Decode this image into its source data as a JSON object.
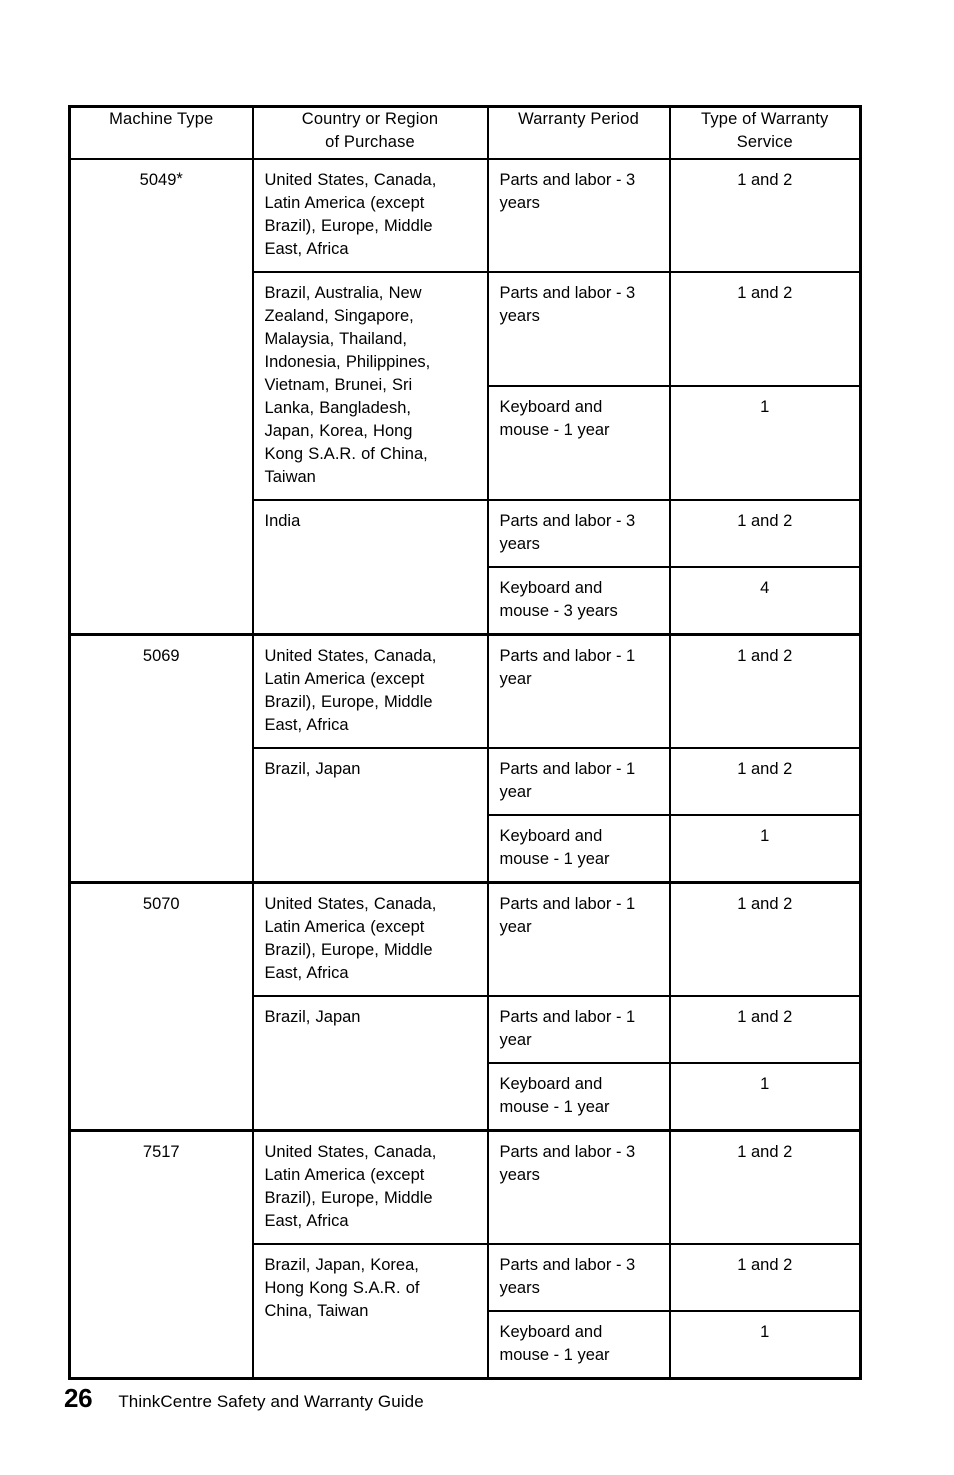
{
  "document": {
    "footer": {
      "page_number": "26",
      "title": "ThinkCentre Safety and Warranty Guide"
    }
  },
  "table": {
    "headers": {
      "machine_type": [
        "Machine Type"
      ],
      "country_or_region": [
        "Country or Region",
        "of Purchase"
      ],
      "warranty_period": [
        "Warranty Period"
      ],
      "type_of_service": [
        "Type of Warranty",
        "Service"
      ]
    },
    "blocks": [
      {
        "machine_type": "5049",
        "machine_type_note": "*",
        "groups": [
          {
            "country_lines": [
              "United States, Canada,",
              "Latin America (except",
              "Brazil), Europe, Middle",
              "East, Africa"
            ],
            "rows": [
              {
                "period_lines": [
                  "Parts and labor - 3",
                  "years"
                ],
                "service": "1 and 2"
              }
            ]
          },
          {
            "country_lines": [
              "Brazil, Australia, New",
              "Zealand, Singapore,",
              "Malaysia, Thailand,",
              "Indonesia, Philippines,",
              "Vietnam, Brunei, Sri",
              "Lanka, Bangladesh,",
              "Japan, Korea, Hong",
              "Kong S.A.R. of China,",
              "Taiwan"
            ],
            "rows": [
              {
                "period_lines": [
                  "Parts and labor - 3",
                  "years"
                ],
                "service": "1 and 2"
              },
              {
                "period_lines": [
                  "Keyboard and",
                  "mouse - 1 year"
                ],
                "service": "1"
              }
            ]
          },
          {
            "country_lines": [
              "India"
            ],
            "rows": [
              {
                "period_lines": [
                  "Parts and labor - 3",
                  "years"
                ],
                "service": "1 and 2"
              },
              {
                "period_lines": [
                  "Keyboard and",
                  "mouse - 3 years"
                ],
                "service": "4"
              }
            ]
          }
        ]
      },
      {
        "machine_type": "5069",
        "machine_type_note": "",
        "groups": [
          {
            "country_lines": [
              "United States, Canada,",
              "Latin America (except",
              "Brazil), Europe, Middle",
              "East, Africa"
            ],
            "rows": [
              {
                "period_lines": [
                  "Parts and labor - 1",
                  "year"
                ],
                "service": "1 and 2"
              }
            ]
          },
          {
            "country_lines": [
              "Brazil, Japan"
            ],
            "rows": [
              {
                "period_lines": [
                  "Parts and labor - 1",
                  "year"
                ],
                "service": "1 and 2"
              },
              {
                "period_lines": [
                  "Keyboard and",
                  "mouse - 1 year"
                ],
                "service": "1"
              }
            ]
          }
        ]
      },
      {
        "machine_type": "5070",
        "machine_type_note": "",
        "groups": [
          {
            "country_lines": [
              "United States, Canada,",
              "Latin America (except",
              "Brazil), Europe, Middle",
              "East, Africa"
            ],
            "rows": [
              {
                "period_lines": [
                  "Parts and labor - 1",
                  "year"
                ],
                "service": "1 and 2"
              }
            ]
          },
          {
            "country_lines": [
              "Brazil, Japan"
            ],
            "rows": [
              {
                "period_lines": [
                  "Parts and labor - 1",
                  "year"
                ],
                "service": "1 and 2"
              },
              {
                "period_lines": [
                  "Keyboard and",
                  "mouse - 1 year"
                ],
                "service": "1"
              }
            ]
          }
        ]
      },
      {
        "machine_type": "7517",
        "machine_type_note": "",
        "groups": [
          {
            "country_lines": [
              "United States, Canada,",
              "Latin America (except",
              "Brazil), Europe, Middle",
              "East, Africa"
            ],
            "rows": [
              {
                "period_lines": [
                  "Parts and labor - 3",
                  "years"
                ],
                "service": "1 and 2"
              }
            ]
          },
          {
            "country_lines": [
              "Brazil, Japan, Korea,",
              "Hong Kong S.A.R. of",
              "China, Taiwan"
            ],
            "rows": [
              {
                "period_lines": [
                  "Parts and labor - 3",
                  "years"
                ],
                "service": "1 and 2"
              },
              {
                "period_lines": [
                  "Keyboard and",
                  "mouse - 1 year"
                ],
                "service": "1"
              }
            ]
          }
        ]
      }
    ]
  }
}
